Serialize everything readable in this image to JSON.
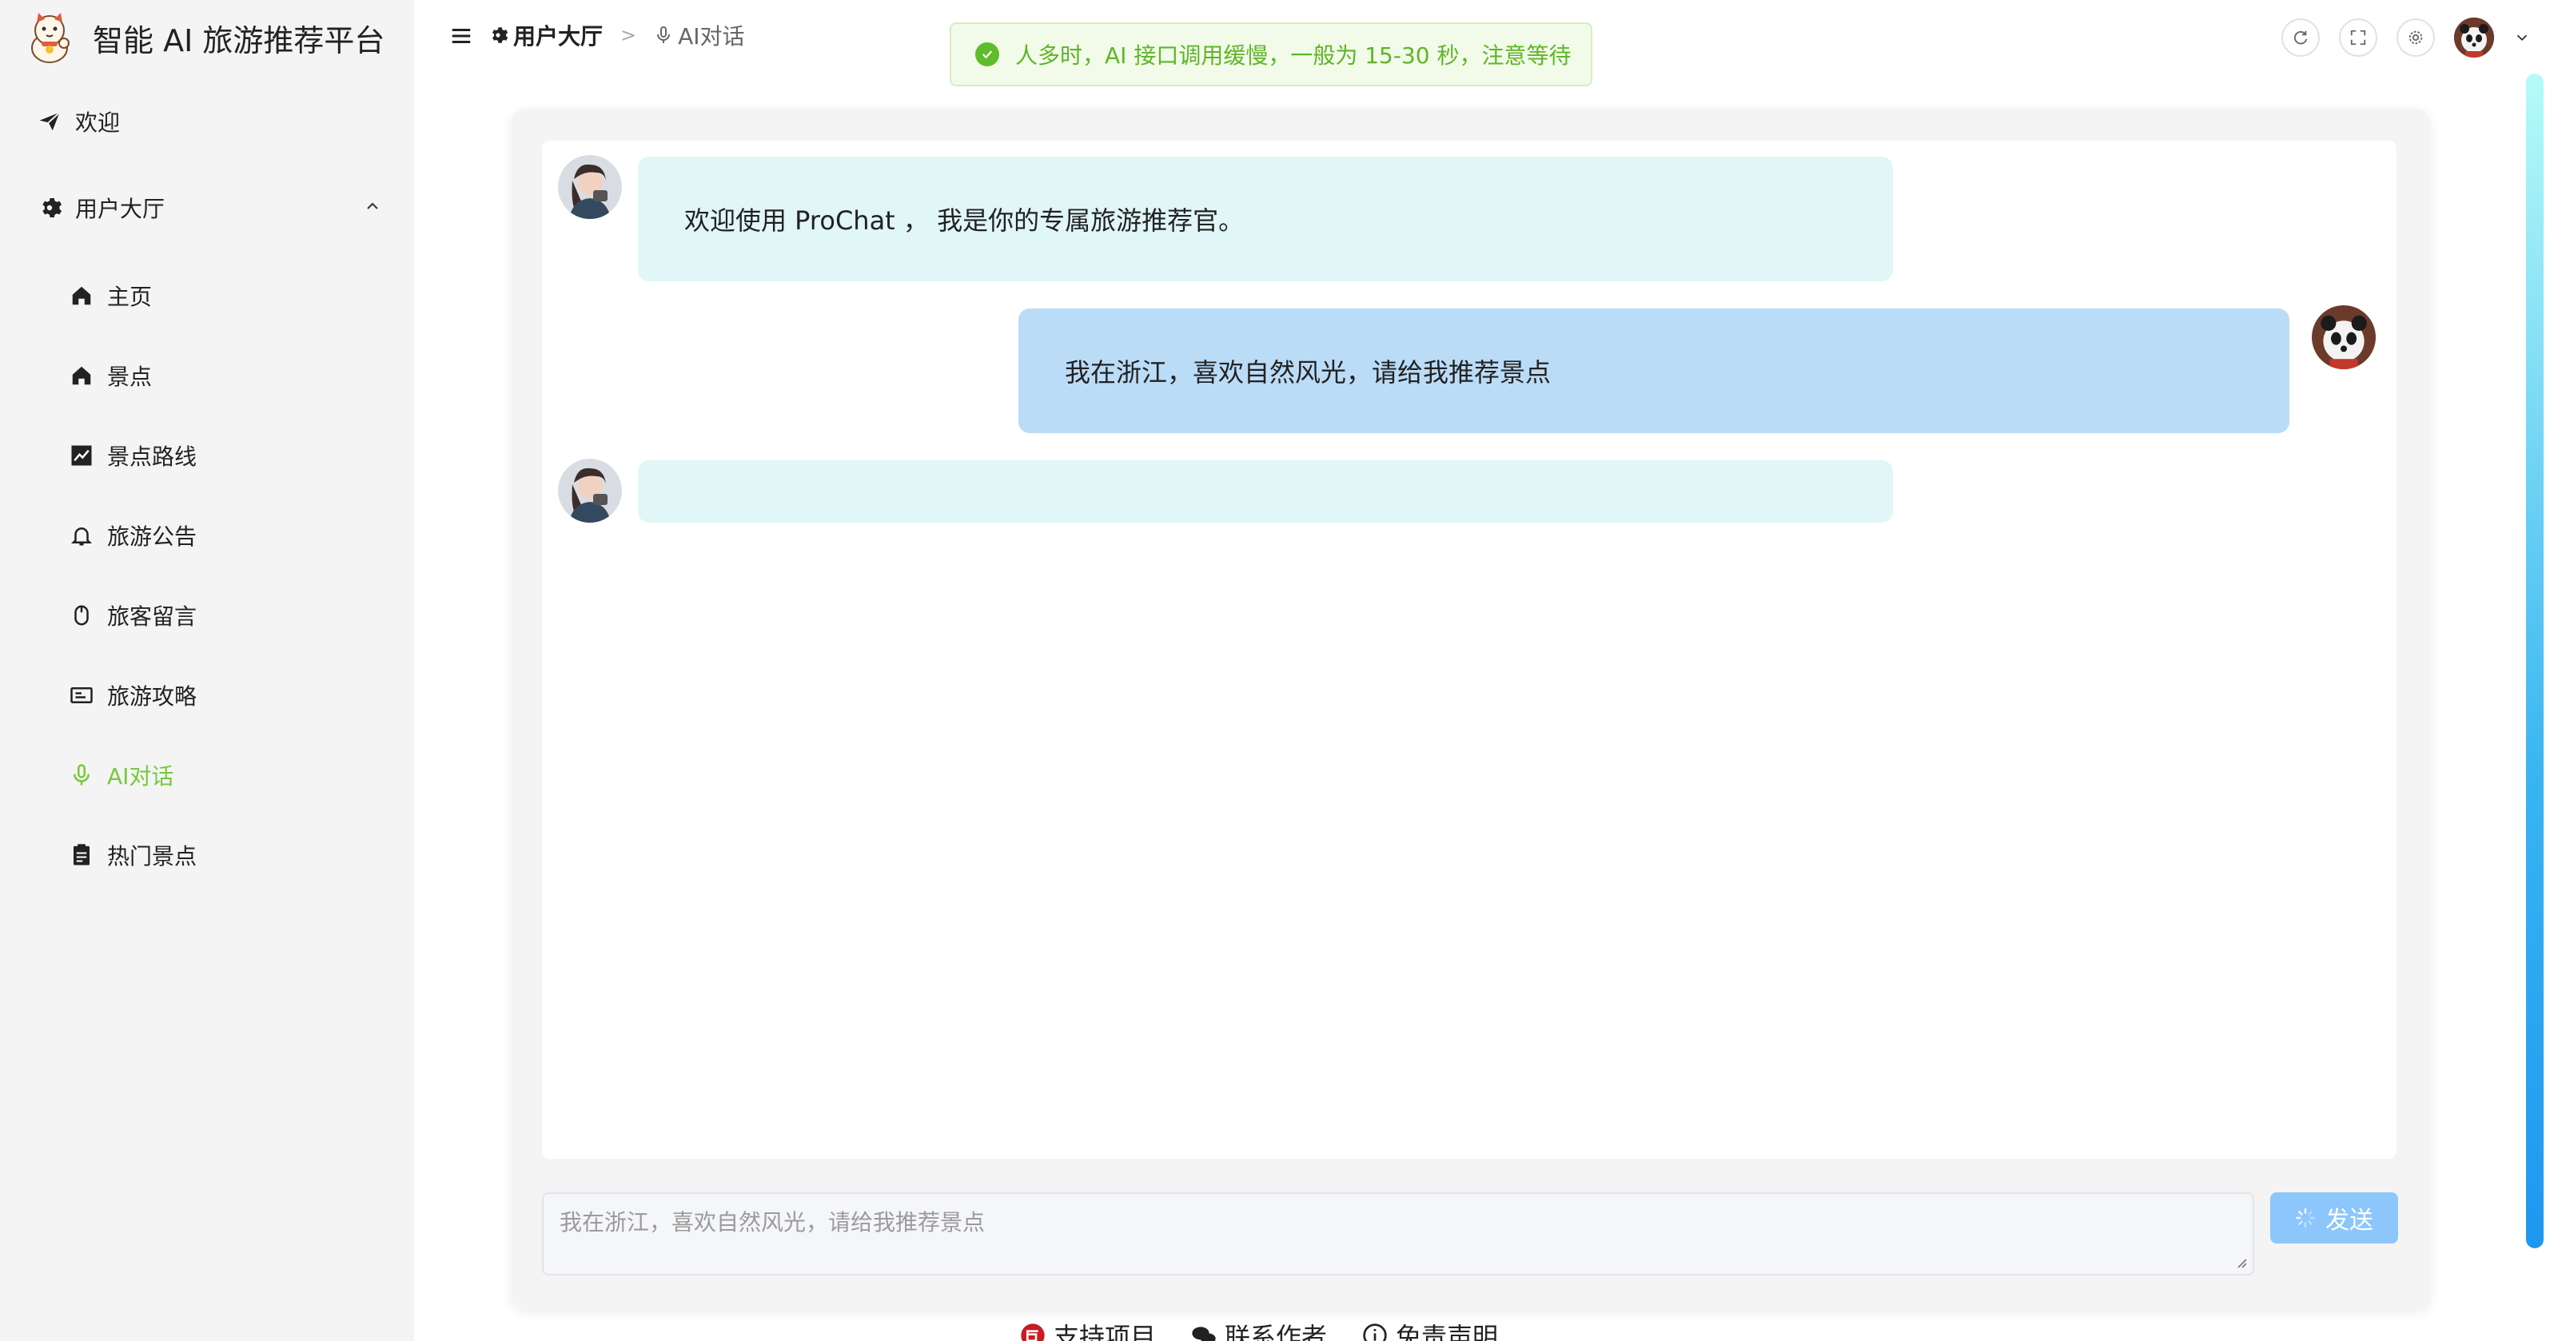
{
  "app": {
    "title": "智能 AI 旅游推荐平台"
  },
  "sidebar": {
    "items": [
      {
        "label": "欢迎",
        "icon": "send-icon",
        "level": 1
      },
      {
        "label": "用户大厅",
        "icon": "gear-icon",
        "level": 1,
        "expanded": true
      },
      {
        "label": "主页",
        "icon": "home-icon",
        "level": 2
      },
      {
        "label": "景点",
        "icon": "home-icon",
        "level": 2
      },
      {
        "label": "景点路线",
        "icon": "chart-icon",
        "level": 2
      },
      {
        "label": "旅游公告",
        "icon": "bell-icon",
        "level": 2
      },
      {
        "label": "旅客留言",
        "icon": "mouse-icon",
        "level": 2
      },
      {
        "label": "旅游攻略",
        "icon": "card-icon",
        "level": 2
      },
      {
        "label": "AI对话",
        "icon": "mic-icon",
        "level": 2,
        "active": true
      },
      {
        "label": "热门景点",
        "icon": "clipboard-icon",
        "level": 2
      }
    ]
  },
  "header": {
    "breadcrumb": [
      "用户大厅",
      "AI对话"
    ]
  },
  "toast": {
    "message": "人多时，AI 接口调用缓慢，一般为 15-30 秒，注意等待",
    "type": "success"
  },
  "chat": {
    "messages": [
      {
        "role": "assistant",
        "text": "欢迎使用 ProChat ， 我是你的专属旅游推荐官。"
      },
      {
        "role": "user",
        "text": "我在浙江，喜欢自然风光，请给我推荐景点"
      },
      {
        "role": "assistant",
        "text": ""
      }
    ],
    "input": {
      "placeholder": "我在浙江，喜欢自然风光，请给我推荐景点",
      "value": ""
    },
    "send_label": "发送",
    "send_loading": true
  },
  "footer": {
    "links": [
      "支持项目",
      "联系作者",
      "免责声明"
    ]
  },
  "colors": {
    "active": "#76c93c",
    "ai_bubble": "#e0f6f7",
    "user_bubble": "#bbdcf7",
    "send_button": "#8cc6fb",
    "toast_text": "#5fb528"
  }
}
